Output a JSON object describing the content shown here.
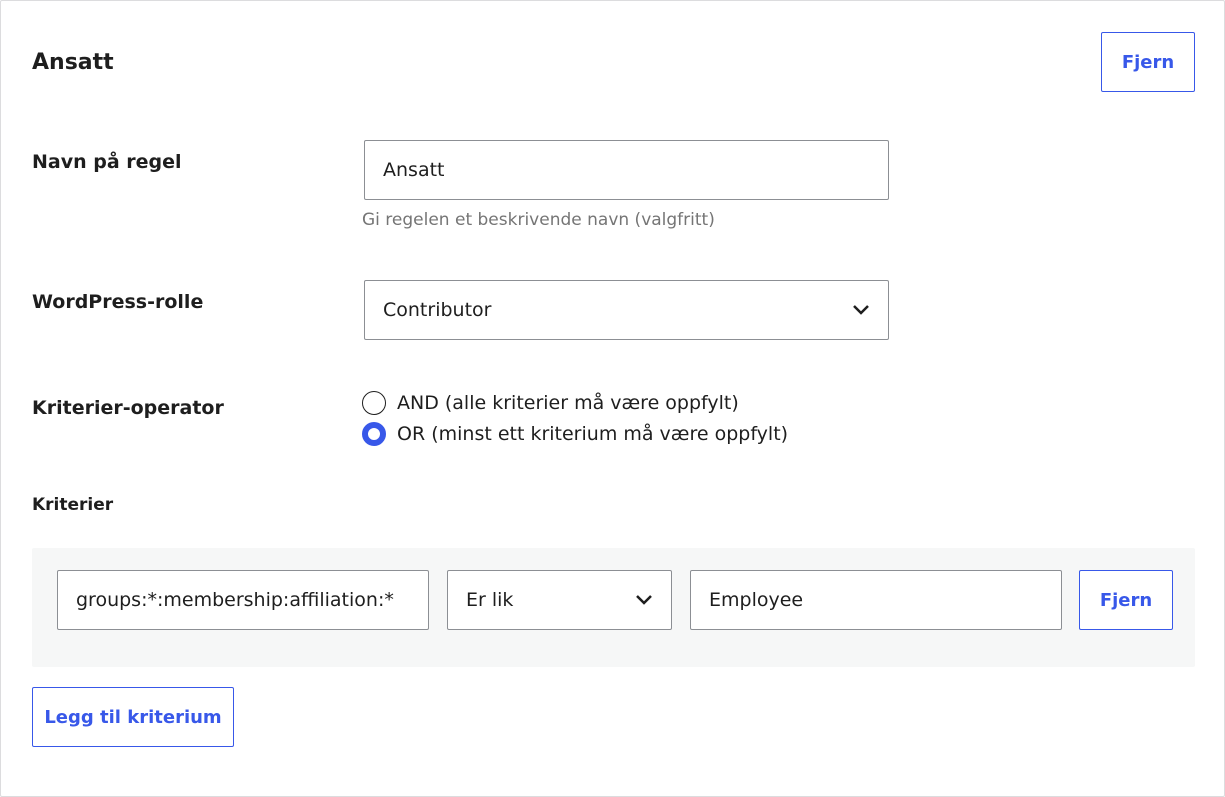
{
  "rule": {
    "title": "Ansatt",
    "remove_label": "Fjern"
  },
  "form": {
    "name_label": "Navn på regel",
    "name_value": "Ansatt",
    "name_help": "Gi regelen et beskrivende navn (valgfritt)",
    "role_label": "WordPress-rolle",
    "role_value": "Contributor",
    "operator_label": "Kriterier-operator",
    "operator_options": [
      {
        "label": "AND (alle kriterier må være oppfylt)",
        "checked": false
      },
      {
        "label": "OR (minst ett kriterium må være oppfylt)",
        "checked": true
      }
    ]
  },
  "criteria": {
    "label": "Kriterier",
    "items": [
      {
        "attribute": "groups:*:membership:affiliation:*",
        "comparator": "Er lik",
        "value": "Employee",
        "remove_label": "Fjern"
      }
    ],
    "add_label": "Legg til kriterium"
  },
  "colors": {
    "accent": "#3858e9",
    "border": "#8c8f94",
    "help_text": "#757575",
    "criteria_bg": "#f6f7f7"
  },
  "icons": {
    "select_chevron": "chevron-down-icon"
  }
}
